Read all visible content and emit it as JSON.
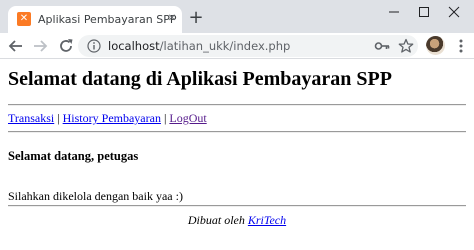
{
  "browser": {
    "tab": {
      "title": "Aplikasi Pembayaran SPP",
      "favicon": "xampp-icon",
      "close_glyph": "✕"
    },
    "new_tab_glyph": "+",
    "address": {
      "host": "localhost",
      "path": "/latihan_ukk/index.php"
    },
    "icons": [
      "back-arrow-icon",
      "forward-arrow-icon",
      "reload-icon",
      "info-icon",
      "key-icon",
      "star-icon",
      "avatar",
      "menu-icon"
    ],
    "colors": {
      "tabstrip": "#dee1e6",
      "omnibox": "#f1f3f4",
      "favicon": "#fb7a24"
    }
  },
  "page": {
    "title": "Selamat datang di Aplikasi Pembayaran SPP",
    "nav": {
      "links": [
        "Transaksi",
        "History Pembayaran",
        "LogOut"
      ],
      "separator": " | "
    },
    "welcome": "Selamat datang, petugas",
    "message": "Silahkan dikelola dengan baik yaa :)",
    "footer": {
      "prefix": "Dibuat oleh ",
      "author": "KriTech"
    },
    "colors": {
      "link": "#0000ee",
      "visited_link": "#551a8b"
    }
  }
}
